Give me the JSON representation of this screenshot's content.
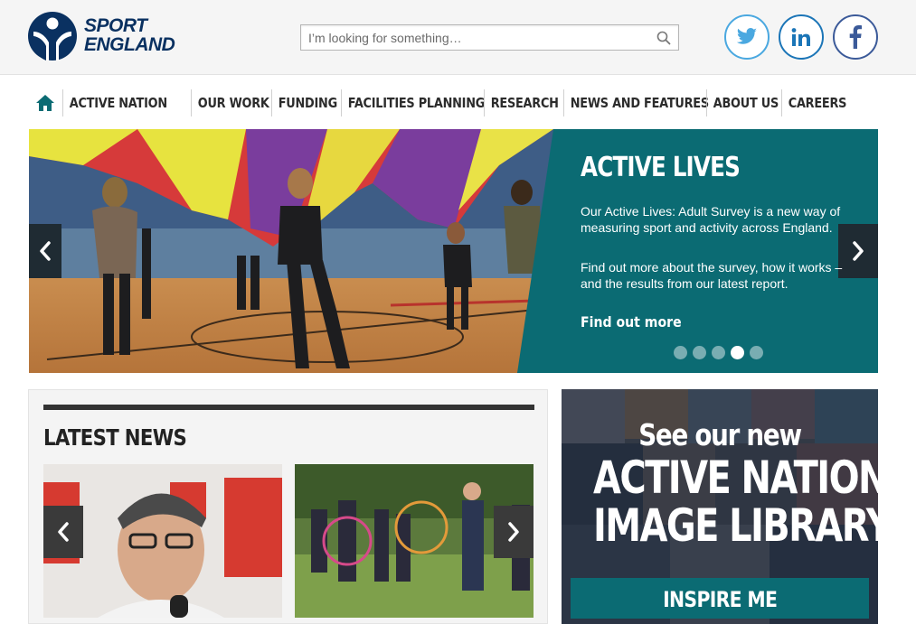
{
  "brand": {
    "name_line1": "SPORT",
    "name_line2": "ENGLAND",
    "primary_color": "#0a3161",
    "accent_color": "#0b6b73"
  },
  "search": {
    "placeholder": "I’m looking for something…",
    "icon": "search-icon"
  },
  "social": [
    {
      "name": "twitter",
      "icon": "twitter-icon",
      "color": "#4aa8e0"
    },
    {
      "name": "linkedin",
      "icon": "linkedin-icon",
      "color": "#1b75b7"
    },
    {
      "name": "facebook",
      "icon": "facebook-icon",
      "color": "#3b5a99"
    }
  ],
  "nav": {
    "home_icon": "home-icon",
    "items": [
      {
        "label": "ACTIVE NATION"
      },
      {
        "label": "OUR WORK"
      },
      {
        "label": "FUNDING"
      },
      {
        "label": "FACILITIES PLANNING"
      },
      {
        "label": "RESEARCH"
      },
      {
        "label": "NEWS AND FEATURES"
      },
      {
        "label": "ABOUT US"
      },
      {
        "label": "CAREERS"
      }
    ]
  },
  "hero": {
    "title": "ACTIVE LIVES",
    "paragraph1": "Our Active Lives: Adult Survey is a new way of measuring sport and activity across England.",
    "paragraph2": "Find out more about the survey, how it works – and the results from our latest report.",
    "link": "Find out more",
    "slide_count": 5,
    "active_slide": 4
  },
  "news": {
    "heading": "LATEST NEWS"
  },
  "promo": {
    "line1": "See our new",
    "line2": "ACTIVE NATION",
    "line3": "IMAGE LIBRARY",
    "button": "INSPIRE ME"
  }
}
